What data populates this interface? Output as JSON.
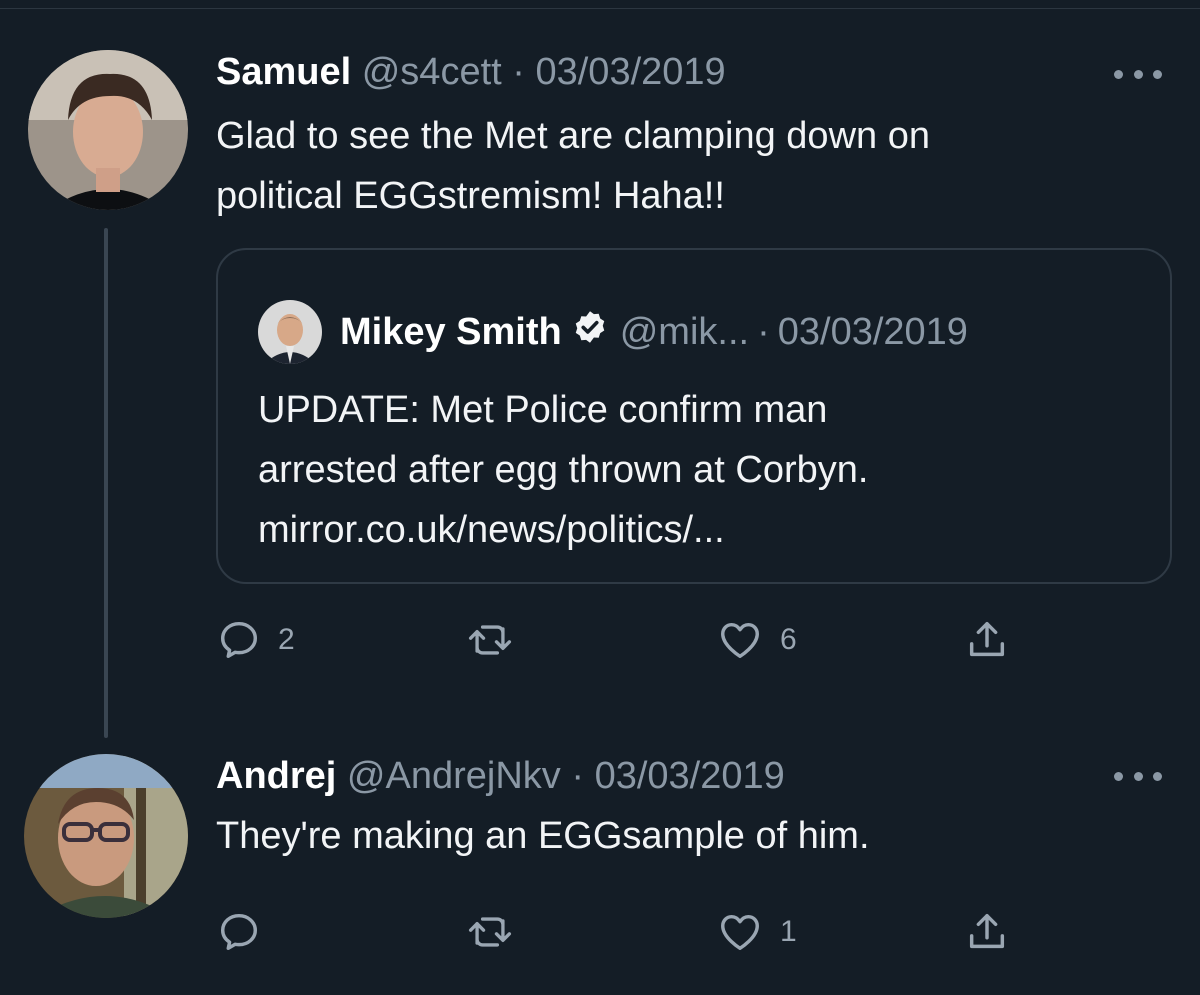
{
  "tweets": [
    {
      "display_name": "Samuel",
      "handle": "@s4cett",
      "separator": "·",
      "date": "03/03/2019",
      "text_lines": [
        "Glad to see the Met are clamping down on",
        "political EGGstremism! Haha!!"
      ],
      "quoted": {
        "display_name": "Mikey Smith",
        "verified": true,
        "handle": "@mik...",
        "separator": "·",
        "date": "03/03/2019",
        "text_lines": [
          "UPDATE: Met Police confirm man",
          "arrested after egg thrown at Corbyn.",
          "mirror.co.uk/news/politics/..."
        ]
      },
      "actions": {
        "reply_count": "2",
        "retweet_count": "",
        "like_count": "6"
      }
    },
    {
      "display_name": "Andrej",
      "handle": "@AndrejNkv",
      "separator": "·",
      "date": "03/03/2019",
      "text_lines": [
        "They're making an EGGsample of him."
      ],
      "actions": {
        "reply_count": "",
        "retweet_count": "",
        "like_count": "1"
      }
    }
  ],
  "icons": {
    "reply": "reply-icon",
    "retweet": "retweet-icon",
    "like": "like-icon",
    "share": "share-icon",
    "more": "more-icon",
    "verified": "verified-icon"
  },
  "colors": {
    "background": "#141d26",
    "text": "#f2f4f6",
    "muted": "#8b98a5",
    "border": "#2f3a45"
  }
}
